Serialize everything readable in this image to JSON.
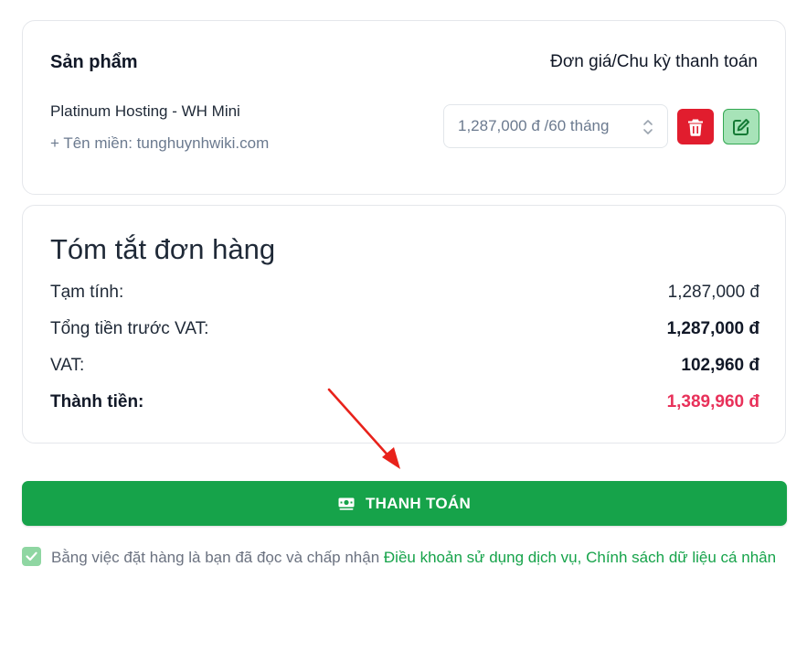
{
  "product_card": {
    "header_left": "Sản phẩm",
    "header_right": "Đơn giá/Chu kỳ thanh toán",
    "product_name": "Platinum Hosting - WH Mini",
    "domain_line": "+ Tên miền: tunghuynhwiki.com",
    "cycle_selected": "1,287,000 đ /60 tháng",
    "delete_icon": "trash-icon",
    "edit_icon": "edit-icon"
  },
  "summary": {
    "title": "Tóm tắt đơn hàng",
    "rows": [
      {
        "label": "Tạm tính:",
        "value": "1,287,000 đ"
      },
      {
        "label": "Tổng tiền trước VAT:",
        "value": "1,287,000 đ"
      },
      {
        "label": "VAT:",
        "value": "102,960 đ"
      },
      {
        "label": "Thành tiền:",
        "value": "1,389,960 đ"
      }
    ]
  },
  "checkout": {
    "button_label": "THANH TOÁN",
    "button_icon": "money-icon"
  },
  "terms": {
    "checked": true,
    "prefix": "Bằng việc đặt hàng là bạn đã đọc và chấp nhận ",
    "link1": "Điều khoản sử dụng dịch vụ",
    "separator": ", ",
    "link2": "Chính sách dữ liệu cá nhân"
  },
  "colors": {
    "primary_green": "#16a34a",
    "delete_red": "#e11d2e",
    "total_pink": "#e8315a",
    "annotation_arrow": "#e8221b"
  }
}
